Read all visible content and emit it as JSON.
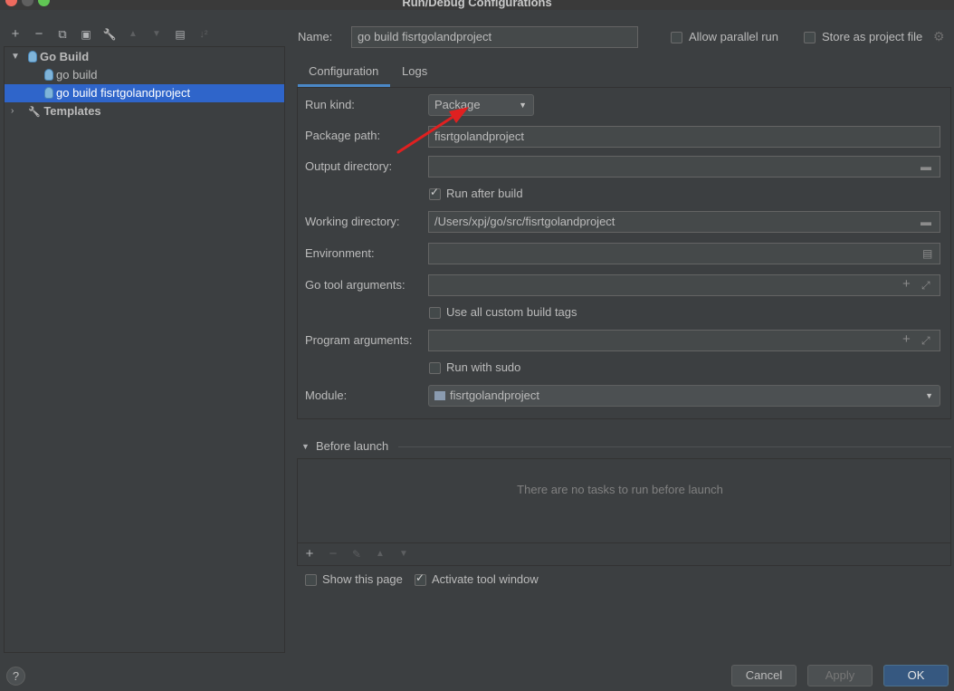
{
  "window": {
    "title": "Run/Debug Configurations"
  },
  "toolbar": {
    "add": "+",
    "remove": "−",
    "copy": "⧉",
    "save": "▣",
    "edit": "🔧",
    "up": "▲",
    "down": "▼",
    "folder": "▤",
    "sort": "↓²"
  },
  "tree": {
    "group": "Go Build",
    "items": [
      "go build",
      "go build fisrtgolandproject"
    ],
    "templates": "Templates"
  },
  "header": {
    "name_label": "Name:",
    "name_value": "go build fisrtgolandproject",
    "allow_parallel": "Allow parallel run",
    "store_project": "Store as project file"
  },
  "tabs": [
    "Configuration",
    "Logs"
  ],
  "form": {
    "run_kind_label": "Run kind:",
    "run_kind_value": "Package",
    "package_path_label": "Package path:",
    "package_path_value": "fisrtgolandproject",
    "output_dir_label": "Output directory:",
    "output_dir_value": "",
    "run_after_build": "Run after build",
    "working_dir_label": "Working directory:",
    "working_dir_value": "/Users/xpj/go/src/fisrtgolandproject",
    "environment_label": "Environment:",
    "go_tool_args_label": "Go tool arguments:",
    "use_custom_tags": "Use all custom build tags",
    "program_args_label": "Program arguments:",
    "run_with_sudo": "Run with sudo",
    "module_label": "Module:",
    "module_value": "fisrtgolandproject"
  },
  "before_launch": {
    "title": "Before launch",
    "empty_text": "There are no tasks to run before launch",
    "show_page": "Show this page",
    "activate_tool": "Activate tool window"
  },
  "footer": {
    "help": "?",
    "cancel": "Cancel",
    "apply": "Apply",
    "ok": "OK"
  },
  "colors": {
    "background": "#3c3f41",
    "selection": "#2f65ca",
    "primary_button": "#365880",
    "annotation_arrow": "#e02020"
  }
}
